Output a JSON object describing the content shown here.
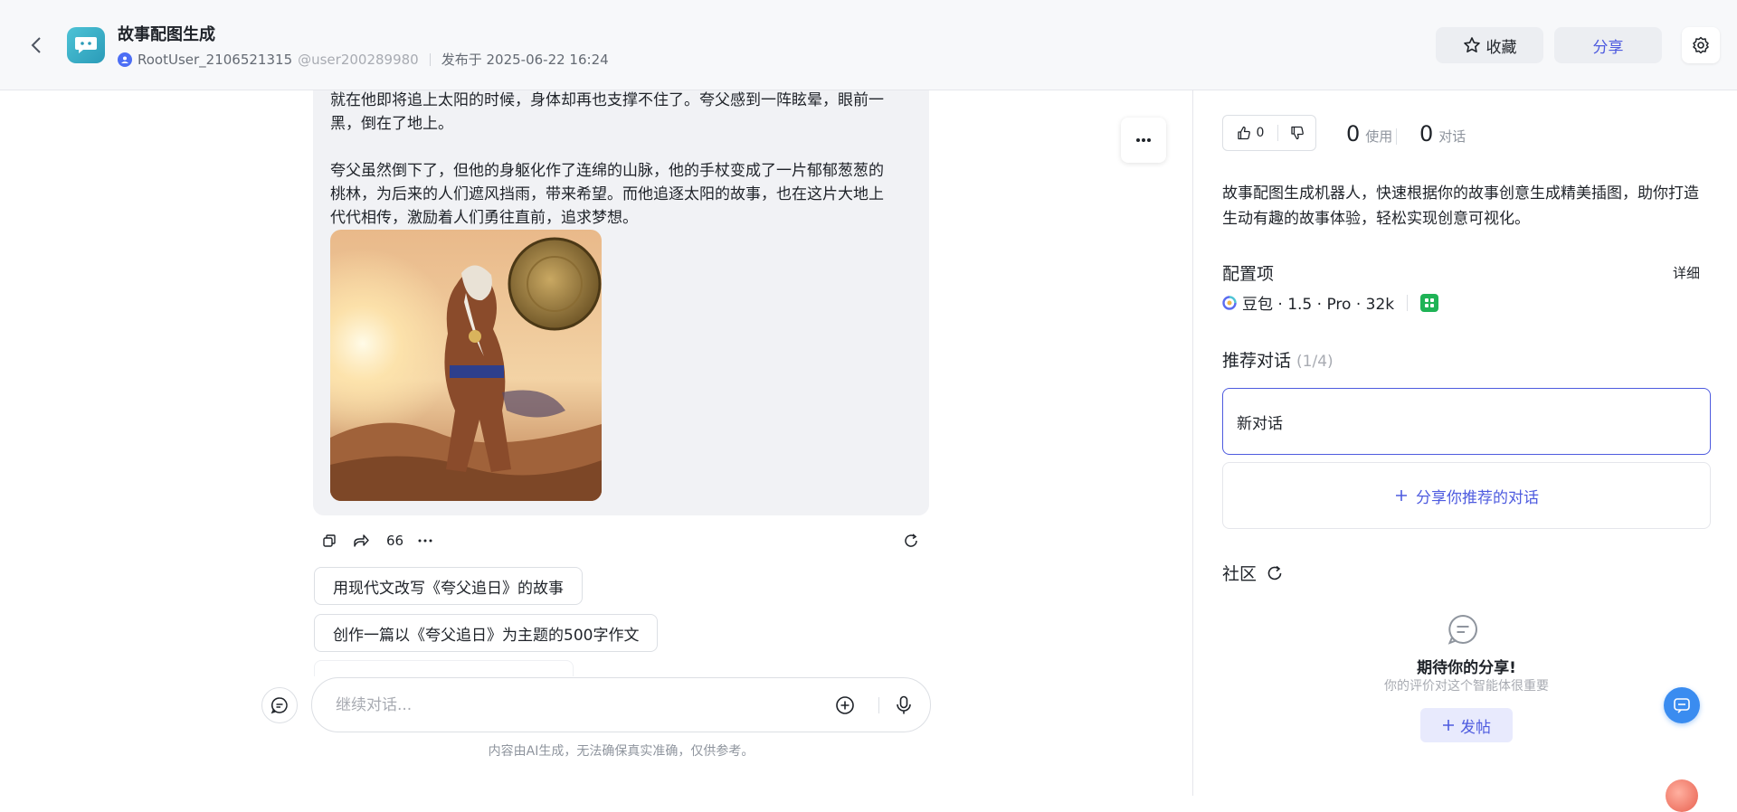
{
  "header": {
    "app_title": "故事配图生成",
    "author": "RootUser_2106521315",
    "handle": "@user200289980",
    "published": "发布于 2025-06-22 16:24",
    "favorite_label": "收藏",
    "share_label": "分享"
  },
  "chat": {
    "paragraph1": [
      "就在他即将追上太阳的时候，身体却再也支撑不住了。夸父感到一阵眩晕，眼前一",
      "黑，倒在了地上。"
    ],
    "paragraph2": [
      "夸父虽然倒下了，但他的身躯化作了连绵的山脉，他的手杖变成了一片郁郁葱葱的",
      "桃林，为后来的人们遮风挡雨，带来希望。而他追逐太阳的故事，也在这片大地上",
      "代代相传，激励着人们勇往直前，追求梦想。"
    ],
    "quote_count": "66",
    "suggestions": [
      "用现代文改写《夸父追日》的故事",
      "创作一篇以《夸父追日》为主题的500字作文"
    ],
    "input_placeholder": "继续对话...",
    "disclaimer": "内容由AI生成，无法确保真实准确，仅供参考。"
  },
  "panel": {
    "likes": "0",
    "usage_count": "0",
    "usage_label": "使用",
    "dialog_count": "0",
    "dialog_label": "对话",
    "description": "故事配图生成机器人，快速根据你的故事创意生成精美插图，助你打造生动有趣的故事体验，轻松实现创意可视化。",
    "config_title": "配置项",
    "detail_label": "详细",
    "model": "豆包 · 1.5 · Pro · 32k",
    "rec_title": "推荐对话",
    "rec_count": "(1/4)",
    "rec_item": "新对话",
    "share_rec_label": "分享你推荐的对话",
    "community_title": "社区",
    "empty_title": "期待你的分享!",
    "empty_sub": "你的评价对这个智能体很重要",
    "post_label": "发帖"
  },
  "colors": {
    "accent": "#4e5bdf",
    "header_bg": "#f7f8fa",
    "bubble_bg": "#f1f2f5",
    "plugin_green": "#1fb356"
  },
  "icons": [
    "back-icon",
    "app-logo-icon",
    "user-icon",
    "star-icon",
    "settings-icon",
    "more-icon",
    "copy-icon",
    "share-icon",
    "ellipsis-icon",
    "refresh-icon",
    "new-chat-icon",
    "add-icon",
    "mic-icon",
    "thumbs-up-icon",
    "thumbs-down-icon",
    "doubao-icon",
    "plugin-icon",
    "plus-icon",
    "comment-icon",
    "chat-support-icon"
  ]
}
